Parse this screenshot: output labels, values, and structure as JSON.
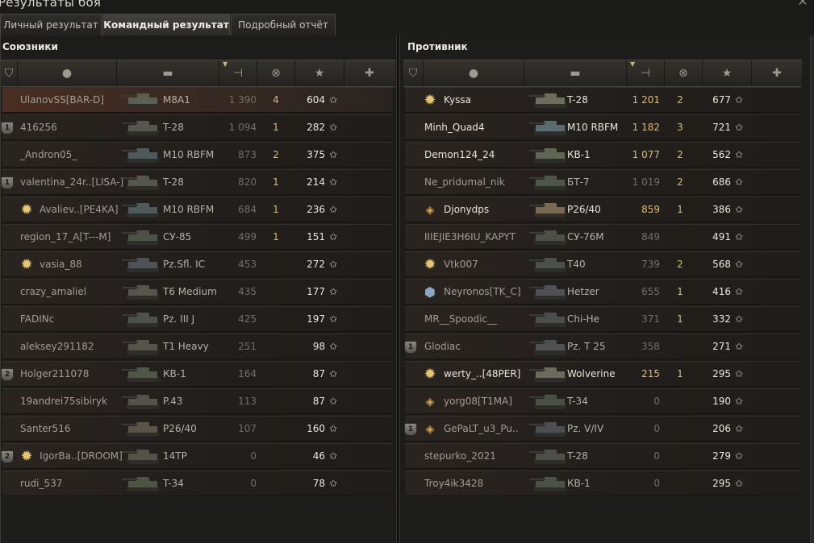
{
  "window": {
    "title": "Результаты боя"
  },
  "tabs": [
    {
      "label": "Личный результат",
      "active": false
    },
    {
      "label": "Командный результат",
      "active": true
    },
    {
      "label": "Подробный отчёт",
      "active": false
    }
  ],
  "columns": {
    "platoon_icon": "shield-icon",
    "player_icon": "person-icon",
    "vehicle_icon": "tank-icon",
    "damage_icon": "gun-icon",
    "kills_icon": "destroyed-tank-icon",
    "xp_icon": "star-icon",
    "medal_icon": "medal-icon",
    "sorted_by": "damage"
  },
  "colors": {
    "accent_gold": "#e0bd64",
    "highlight_row": "#4a2e22",
    "text_bright": "#e9e5da",
    "text_dim": "#a19d94"
  },
  "allies": {
    "title": "Союзники",
    "rows": [
      {
        "platoon": "",
        "badge": "",
        "name": "UlanovSS[BAR-D]",
        "bright": false,
        "vehicle": "M8A1",
        "damage": "1 390",
        "damage_gold": false,
        "kills": "4",
        "xp": "604",
        "highlight": true,
        "tank_color": "#5d5f52"
      },
      {
        "platoon": "1",
        "badge": "",
        "name": "416256",
        "bright": false,
        "vehicle": "T-28",
        "damage": "1 094",
        "damage_gold": false,
        "kills": "1",
        "xp": "282",
        "highlight": false,
        "tank_color": "#55574c"
      },
      {
        "platoon": "",
        "badge": "",
        "name": "_Andron05_",
        "bright": false,
        "vehicle": "M10 RBFM",
        "damage": "873",
        "damage_gold": false,
        "kills": "2",
        "xp": "375",
        "highlight": false,
        "tank_color": "#4f5a5c"
      },
      {
        "platoon": "1",
        "badge": "",
        "name": "valentina_24r..[LISA-]",
        "bright": false,
        "vehicle": "T-28",
        "damage": "820",
        "damage_gold": false,
        "kills": "1",
        "xp": "214",
        "highlight": false,
        "tank_color": "#55574c"
      },
      {
        "platoon": "",
        "badge": "sun",
        "name": "Avaliev..[PE4KA]",
        "bright": false,
        "vehicle": "M10 RBFM",
        "damage": "684",
        "damage_gold": false,
        "kills": "1",
        "xp": "236",
        "highlight": false,
        "tank_color": "#4f5a5c"
      },
      {
        "platoon": "",
        "badge": "",
        "name": "region_17_A[T---M]",
        "bright": false,
        "vehicle": "СУ-85",
        "damage": "499",
        "damage_gold": false,
        "kills": "1",
        "xp": "151",
        "highlight": false,
        "tank_color": "#4d5246"
      },
      {
        "platoon": "",
        "badge": "sun",
        "name": "vasia_88",
        "bright": false,
        "vehicle": "Pz.Sfl. IC",
        "damage": "453",
        "damage_gold": false,
        "kills": "",
        "xp": "272",
        "highlight": false,
        "tank_color": "#505356"
      },
      {
        "platoon": "",
        "badge": "",
        "name": "crazy_amaliel",
        "bright": false,
        "vehicle": "T6 Medium",
        "damage": "435",
        "damage_gold": false,
        "kills": "",
        "xp": "177",
        "highlight": false,
        "tank_color": "#57544a"
      },
      {
        "platoon": "",
        "badge": "",
        "name": "FADINc",
        "bright": false,
        "vehicle": "Pz. III J",
        "damage": "425",
        "damage_gold": false,
        "kills": "",
        "xp": "197",
        "highlight": false,
        "tank_color": "#4e504c"
      },
      {
        "platoon": "",
        "badge": "",
        "name": "aleksey291182",
        "bright": false,
        "vehicle": "T1 Heavy",
        "damage": "251",
        "damage_gold": false,
        "kills": "",
        "xp": "98",
        "highlight": false,
        "tank_color": "#555449"
      },
      {
        "platoon": "2",
        "badge": "",
        "name": "Holger211078",
        "bright": false,
        "vehicle": "КВ-1",
        "damage": "164",
        "damage_gold": false,
        "kills": "",
        "xp": "87",
        "highlight": false,
        "tank_color": "#4f5747"
      },
      {
        "platoon": "",
        "badge": "",
        "name": "19andrei75sibiryk",
        "bright": false,
        "vehicle": "P.43",
        "damage": "113",
        "damage_gold": false,
        "kills": "",
        "xp": "87",
        "highlight": false,
        "tank_color": "#56524a"
      },
      {
        "platoon": "",
        "badge": "",
        "name": "Santer516",
        "bright": false,
        "vehicle": "P26/40",
        "damage": "107",
        "damage_gold": false,
        "kills": "",
        "xp": "160",
        "highlight": false,
        "tank_color": "#5a5446"
      },
      {
        "platoon": "2",
        "badge": "sun",
        "name": "IgorBa..[DROOM]",
        "bright": false,
        "vehicle": "14TP",
        "damage": "0",
        "damage_gold": false,
        "kills": "",
        "xp": "46",
        "highlight": false,
        "tank_color": "#545244"
      },
      {
        "platoon": "",
        "badge": "",
        "name": "rudi_537",
        "bright": false,
        "vehicle": "T-34",
        "damage": "0",
        "damage_gold": false,
        "kills": "",
        "xp": "78",
        "highlight": false,
        "tank_color": "#4c5443"
      }
    ]
  },
  "enemies": {
    "title": "Противник",
    "rows": [
      {
        "platoon": "",
        "badge": "sun",
        "name": "Kyssa",
        "bright": true,
        "vehicle": "T-28",
        "damage": "1 201",
        "damage_gold": true,
        "kills": "2",
        "xp": "677",
        "highlight": false,
        "tank_color": "#6a6e5a"
      },
      {
        "platoon": "",
        "badge": "",
        "name": "Minh_Quad4",
        "bright": true,
        "vehicle": "M10 RBFM",
        "damage": "1 182",
        "damage_gold": true,
        "kills": "3",
        "xp": "721",
        "highlight": false,
        "tank_color": "#5b6a6e"
      },
      {
        "platoon": "",
        "badge": "",
        "name": "Demon124_24",
        "bright": true,
        "vehicle": "КВ-1",
        "damage": "1 077",
        "damage_gold": true,
        "kills": "2",
        "xp": "562",
        "highlight": false,
        "tank_color": "#5e6654"
      },
      {
        "platoon": "",
        "badge": "",
        "name": "Ne_pridumal_nik",
        "bright": false,
        "vehicle": "БТ-7",
        "damage": "1 019",
        "damage_gold": false,
        "kills": "2",
        "xp": "686",
        "highlight": false,
        "tank_color": "#4f5549"
      },
      {
        "platoon": "",
        "badge": "diamond",
        "name": "Djonydps",
        "bright": true,
        "vehicle": "P26/40",
        "damage": "859",
        "damage_gold": true,
        "kills": "1",
        "xp": "386",
        "highlight": false,
        "tank_color": "#7a6a52"
      },
      {
        "platoon": "",
        "badge": "",
        "name": "IIIEJIE3H6IU_KAPYT",
        "bright": false,
        "vehicle": "СУ-76М",
        "damage": "849",
        "damage_gold": false,
        "kills": "",
        "xp": "491",
        "highlight": false,
        "tank_color": "#4c5046"
      },
      {
        "platoon": "",
        "badge": "sun",
        "name": "Vtk007",
        "bright": false,
        "vehicle": "T40",
        "damage": "739",
        "damage_gold": false,
        "kills": "2",
        "xp": "568",
        "highlight": false,
        "tank_color": "#4d4f4c"
      },
      {
        "platoon": "",
        "badge": "hex",
        "name": "Neyronos[TK_C]",
        "bright": false,
        "vehicle": "Hetzer",
        "damage": "655",
        "damage_gold": false,
        "kills": "1",
        "xp": "416",
        "highlight": false,
        "tank_color": "#4e5256"
      },
      {
        "platoon": "",
        "badge": "",
        "name": "MR__Spoodic__",
        "bright": false,
        "vehicle": "Chi-He",
        "damage": "371",
        "damage_gold": false,
        "kills": "1",
        "xp": "332",
        "highlight": false,
        "tank_color": "#4b4e4a"
      },
      {
        "platoon": "1",
        "badge": "",
        "name": "Glodiac",
        "bright": false,
        "vehicle": "Pz. T 25",
        "damage": "358",
        "damage_gold": false,
        "kills": "",
        "xp": "271",
        "highlight": false,
        "tank_color": "#4e5052"
      },
      {
        "platoon": "",
        "badge": "sun",
        "name": "werty_..[48PER]",
        "bright": true,
        "vehicle": "Wolverine",
        "damage": "215",
        "damage_gold": true,
        "kills": "1",
        "xp": "295",
        "highlight": false,
        "tank_color": "#6c6a5c"
      },
      {
        "platoon": "",
        "badge": "diamond",
        "name": "yorg08[T1MA]",
        "bright": false,
        "vehicle": "T-34",
        "damage": "0",
        "damage_gold": false,
        "kills": "",
        "xp": "190",
        "highlight": false,
        "tank_color": "#4a5043"
      },
      {
        "platoon": "1",
        "badge": "diamond",
        "name": "GePaLT_u3_Pu..",
        "bright": false,
        "vehicle": "Pz. V/IV",
        "damage": "0",
        "damage_gold": false,
        "kills": "",
        "xp": "206",
        "highlight": false,
        "tank_color": "#4c4f53"
      },
      {
        "platoon": "",
        "badge": "",
        "name": "stepurko_2021",
        "bright": false,
        "vehicle": "T-28",
        "damage": "0",
        "damage_gold": false,
        "kills": "",
        "xp": "279",
        "highlight": false,
        "tank_color": "#4d4f47"
      },
      {
        "platoon": "",
        "badge": "",
        "name": "Troy4ik3428",
        "bright": false,
        "vehicle": "КВ-1",
        "damage": "0",
        "damage_gold": false,
        "kills": "",
        "xp": "295",
        "highlight": false,
        "tank_color": "#4d5246"
      }
    ]
  }
}
